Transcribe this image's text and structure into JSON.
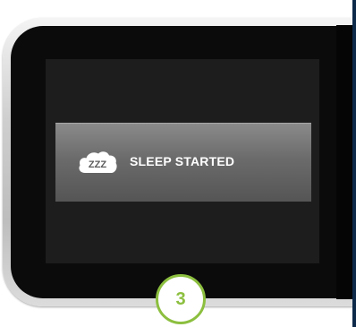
{
  "banner": {
    "label": "SLEEP STARTED",
    "icon_text": "ZZZ",
    "icon": "sleep-cloud-icon"
  },
  "step_badge": {
    "number": "3"
  },
  "colors": {
    "badge_accent": "#8cbf3f",
    "banner_top": "#8a8a8a",
    "banner_bottom": "#555555",
    "screen_bg": "#1d1d1d",
    "side_edge": "#0e2a4a"
  }
}
